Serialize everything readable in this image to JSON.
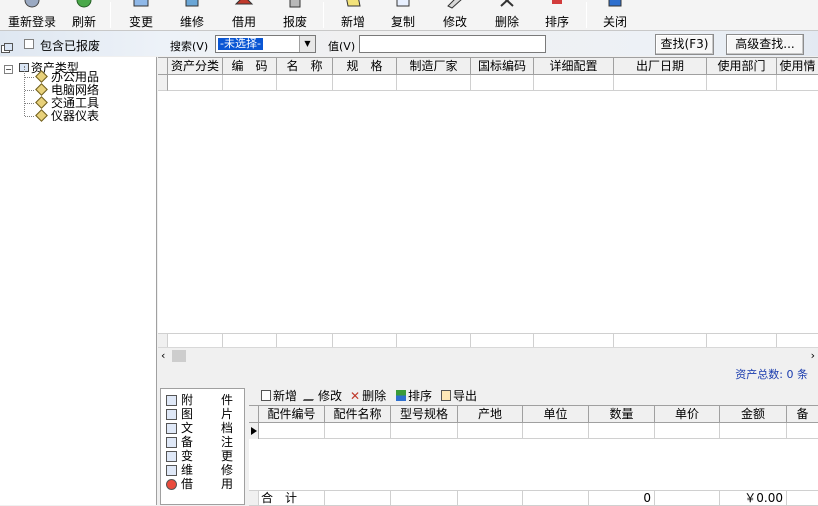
{
  "toolbar": {
    "buttons": [
      {
        "label": "重新登录",
        "icon": "relogin-icon"
      },
      {
        "label": "刷新",
        "icon": "refresh-icon"
      },
      {
        "label": "变更",
        "icon": "change-icon"
      },
      {
        "label": "维修",
        "icon": "repair-icon"
      },
      {
        "label": "借用",
        "icon": "borrow-icon"
      },
      {
        "label": "报废",
        "icon": "scrap-icon"
      },
      {
        "label": "新增",
        "icon": "new-icon"
      },
      {
        "label": "复制",
        "icon": "copy-icon"
      },
      {
        "label": "修改",
        "icon": "edit-icon"
      },
      {
        "label": "删除",
        "icon": "delete-icon"
      },
      {
        "label": "排序",
        "icon": "sort-icon"
      },
      {
        "label": "关闭",
        "icon": "close-icon"
      }
    ]
  },
  "filter": {
    "include_scrapped_label": "包含已报废",
    "search_label": "搜索(V)",
    "search_selected": "-未选择-",
    "value_label": "值(V)",
    "value": "",
    "find_button": "查找(F3)",
    "advanced_button": "高级查找..."
  },
  "tree": {
    "root": "资产类型",
    "children": [
      "办公用品",
      "电脑网络",
      "交通工具",
      "仪器仪表"
    ]
  },
  "grid": {
    "columns": [
      "资产分类",
      "编　码",
      "名　称",
      "规　格",
      "制造厂家",
      "国标编码",
      "详细配置",
      "出厂日期",
      "使用部门",
      "使用情"
    ]
  },
  "status": {
    "total_label": "资产总数: 0 条"
  },
  "attachments": {
    "items": [
      {
        "c1": "附",
        "c2": "件",
        "icon": "attachment-icon"
      },
      {
        "c1": "图",
        "c2": "片",
        "icon": "picture-icon"
      },
      {
        "c1": "文",
        "c2": "档",
        "icon": "document-icon"
      },
      {
        "c1": "备",
        "c2": "注",
        "icon": "note-icon"
      },
      {
        "c1": "变",
        "c2": "更",
        "icon": "change-icon"
      },
      {
        "c1": "维",
        "c2": "修",
        "icon": "repair-icon"
      },
      {
        "c1": "借",
        "c2": "用",
        "icon": "borrow-icon"
      }
    ]
  },
  "subtoolbar": {
    "new": "新增",
    "edit": "修改",
    "delete": "删除",
    "sort": "排序",
    "export": "导出"
  },
  "subgrid": {
    "columns": [
      "配件编号",
      "配件名称",
      "型号规格",
      "产地",
      "单位",
      "数量",
      "单价",
      "金额",
      "备"
    ],
    "total_label": "合　计",
    "total_qty": "0",
    "total_amount": "￥0.00"
  },
  "colors": {
    "selection": "#0a56d4",
    "status_text": "#1a3cae"
  }
}
